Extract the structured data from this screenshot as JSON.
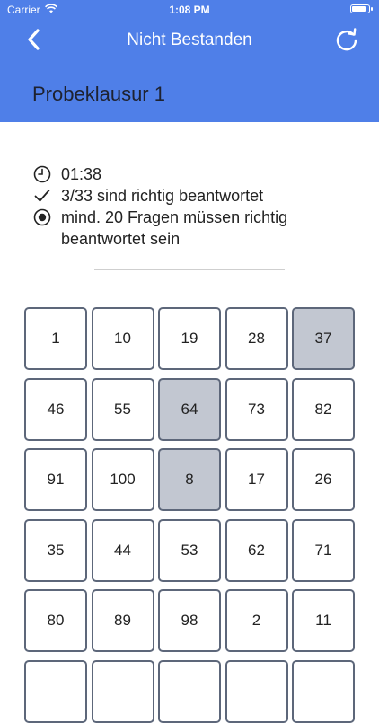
{
  "status_bar": {
    "carrier": "Carrier",
    "time": "1:08 PM"
  },
  "nav": {
    "title": "Nicht Bestanden",
    "back_icon": "chevron-left-icon",
    "refresh_icon": "refresh-icon"
  },
  "header": {
    "title": "Probeklausur 1"
  },
  "info": {
    "time": "01:38",
    "correct": "3/33 sind richtig beantwortet",
    "requirement": "mind. 20 Fragen müssen richtig beantwortet sein"
  },
  "colors": {
    "accent": "#4f7fe8",
    "marked_cell": "#c2c7d1",
    "cell_border": "#5d677a"
  },
  "questions": [
    {
      "label": "1",
      "marked": false
    },
    {
      "label": "10",
      "marked": false
    },
    {
      "label": "19",
      "marked": false
    },
    {
      "label": "28",
      "marked": false
    },
    {
      "label": "37",
      "marked": true
    },
    {
      "label": "46",
      "marked": false
    },
    {
      "label": "55",
      "marked": false
    },
    {
      "label": "64",
      "marked": true
    },
    {
      "label": "73",
      "marked": false
    },
    {
      "label": "82",
      "marked": false
    },
    {
      "label": "91",
      "marked": false
    },
    {
      "label": "100",
      "marked": false
    },
    {
      "label": "8",
      "marked": true
    },
    {
      "label": "17",
      "marked": false
    },
    {
      "label": "26",
      "marked": false
    },
    {
      "label": "35",
      "marked": false
    },
    {
      "label": "44",
      "marked": false
    },
    {
      "label": "53",
      "marked": false
    },
    {
      "label": "62",
      "marked": false
    },
    {
      "label": "71",
      "marked": false
    },
    {
      "label": "80",
      "marked": false
    },
    {
      "label": "89",
      "marked": false
    },
    {
      "label": "98",
      "marked": false
    },
    {
      "label": "2",
      "marked": false
    },
    {
      "label": "11",
      "marked": false
    },
    {
      "label": "",
      "marked": false
    },
    {
      "label": "",
      "marked": false
    },
    {
      "label": "",
      "marked": false
    },
    {
      "label": "",
      "marked": false
    },
    {
      "label": "",
      "marked": false
    }
  ]
}
